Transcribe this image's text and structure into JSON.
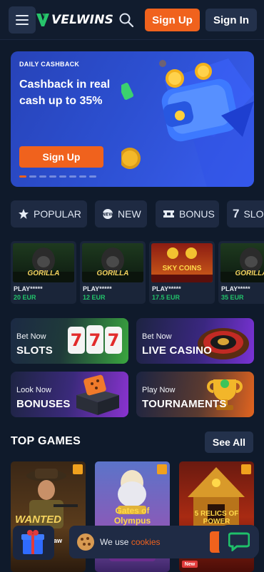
{
  "header": {
    "logo_text": "VELWINS",
    "signup_label": "Sign Up",
    "signin_label": "Sign In"
  },
  "banner": {
    "tag": "DAILY CASHBACK",
    "title": "Cashback in real cash up to 35%",
    "button_label": "Sign Up",
    "slides_total": 8,
    "active_slide": 1
  },
  "categories": [
    {
      "label": "POPULAR",
      "icon": "star-icon"
    },
    {
      "label": "NEW",
      "icon": "new-badge-icon"
    },
    {
      "label": "BONUS",
      "icon": "ticket-icon"
    },
    {
      "label": "SLO",
      "icon": "seven-icon"
    }
  ],
  "games_row": [
    {
      "title": "GORILLA",
      "name": "PLAY*****",
      "price": "20 EUR"
    },
    {
      "title": "GORILLA",
      "name": "PLAY*****",
      "price": "12 EUR"
    },
    {
      "title": "SKY COINS",
      "name": "PLAY*****",
      "price": "17.5 EUR"
    },
    {
      "title": "GORILLA",
      "name": "PLAY*****",
      "price": "35 EUR"
    }
  ],
  "tiles": [
    {
      "sub": "Bet Now",
      "title": "SLOTS"
    },
    {
      "sub": "Bet Now",
      "title": "LIVE CASINO"
    },
    {
      "sub": "Look Now",
      "title": "BONUSES"
    },
    {
      "sub": "Play Now",
      "title": "TOURNAMENTS"
    }
  ],
  "top_games": {
    "title": "TOP GAMES",
    "see_all_label": "See All",
    "items": [
      {
        "title": "WANTED",
        "caption": "ksaw"
      },
      {
        "title": "Gates of Olympus"
      },
      {
        "title": "5 RELICS OF POWER"
      }
    ]
  },
  "cookie_bar": {
    "text": "We use ",
    "link": "cookies"
  },
  "new_badge": "New",
  "colors": {
    "background": "#0f1a2b",
    "accent": "#f0621d",
    "price_green": "#22c26a",
    "chat_green": "#1fc06a"
  }
}
